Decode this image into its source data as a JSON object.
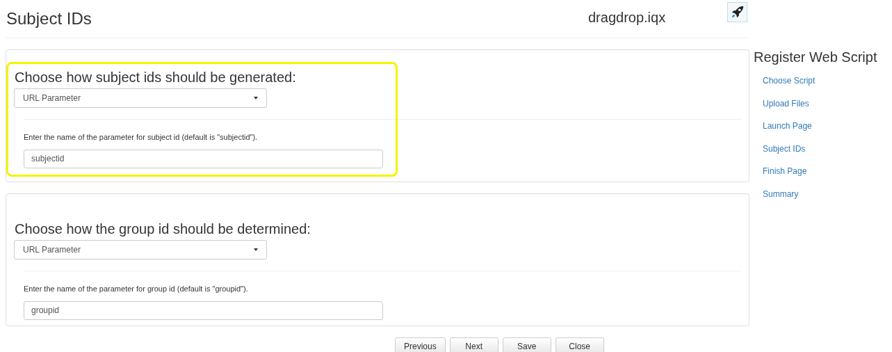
{
  "header": {
    "title": "Subject IDs",
    "filename": "dragdrop.iqx"
  },
  "sections": [
    {
      "heading": "Choose how subject ids should be generated:",
      "highlighted": true,
      "select": "URL Parameter",
      "field_label": "Enter the name of the parameter for subject id (default is \"subjectid\").",
      "field_value": "subjectid"
    },
    {
      "heading": "Choose how the group id should be determined:",
      "highlighted": false,
      "select": "URL Parameter",
      "field_label": "Enter the name of the parameter for group id (default is \"groupid\").",
      "field_value": "groupid"
    }
  ],
  "sidebar": {
    "title": "Register Web Script",
    "items": [
      "Choose Script",
      "Upload Files",
      "Launch Page",
      "Subject IDs",
      "Finish Page",
      "Summary"
    ]
  },
  "buttons": [
    "Previous",
    "Next",
    "Save",
    "Close"
  ]
}
